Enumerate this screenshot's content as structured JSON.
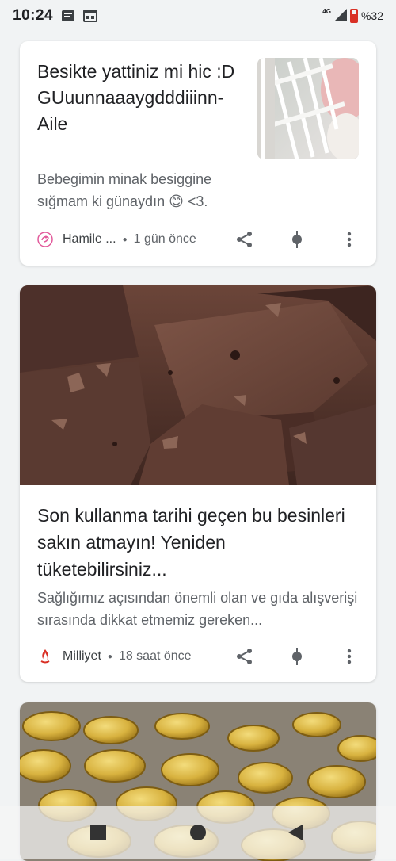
{
  "status_bar": {
    "time": "10:24",
    "network": "4G",
    "battery": "%32",
    "icons": [
      "message-icon",
      "calendar-icon",
      "signal-icon",
      "battery-icon"
    ]
  },
  "cards": [
    {
      "title": "Besikte yattiniz mi hic :D GUuunnaaaygdddiiinn-Aile",
      "snippet": "Bebegimin minak besiggine sığmam ki günaydın 😊 <3.",
      "source": "Hamile ...",
      "time": "1 gün önce",
      "actions": [
        "share-icon",
        "interest-icon",
        "more-icon"
      ]
    },
    {
      "title": "Son kullanma tarihi geçen bu besinleri sakın atmayın! Yeniden tüketebilirsiniz...",
      "snippet": "Sağlığımız açısından önemli olan ve gıda alışverişi sırasında dikkat etmemiz gereken...",
      "source": "Milliyet",
      "time": "18 saat önce",
      "actions": [
        "share-icon",
        "interest-icon",
        "more-icon"
      ]
    }
  ],
  "navigation_bar": {
    "buttons": [
      "recent-apps-button",
      "home-button",
      "back-button"
    ]
  },
  "colors": {
    "background": "#f1f3f4",
    "card": "#ffffff",
    "title": "#202124",
    "secondary": "#5f6368",
    "milliyet_red": "#d93025",
    "hamile_pink": "#e25a9b"
  }
}
